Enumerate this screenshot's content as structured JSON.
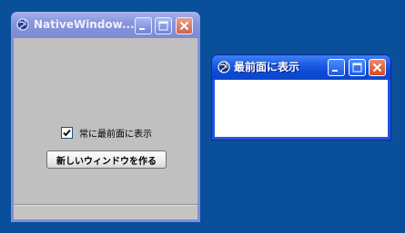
{
  "main_window": {
    "title": "NativeWindow...",
    "always_on_top": {
      "label": "常に最前面に表示",
      "checked": true
    },
    "new_window_button": "新しいウィンドウを作る",
    "status_text": ""
  },
  "topmost_window": {
    "title": "最前面に表示"
  },
  "icons": {
    "window_icon": "globe-icon",
    "minimize": "minimize-icon",
    "maximize": "maximize-icon",
    "close": "close-icon",
    "check": "checkmark-icon"
  },
  "colors": {
    "desktop": "#0a4f9a",
    "active_titlebar": "#1f5fe6",
    "inactive_titlebar": "#8796dc",
    "close_button": "#d24a1f",
    "client_area": "#c0c0c0"
  }
}
